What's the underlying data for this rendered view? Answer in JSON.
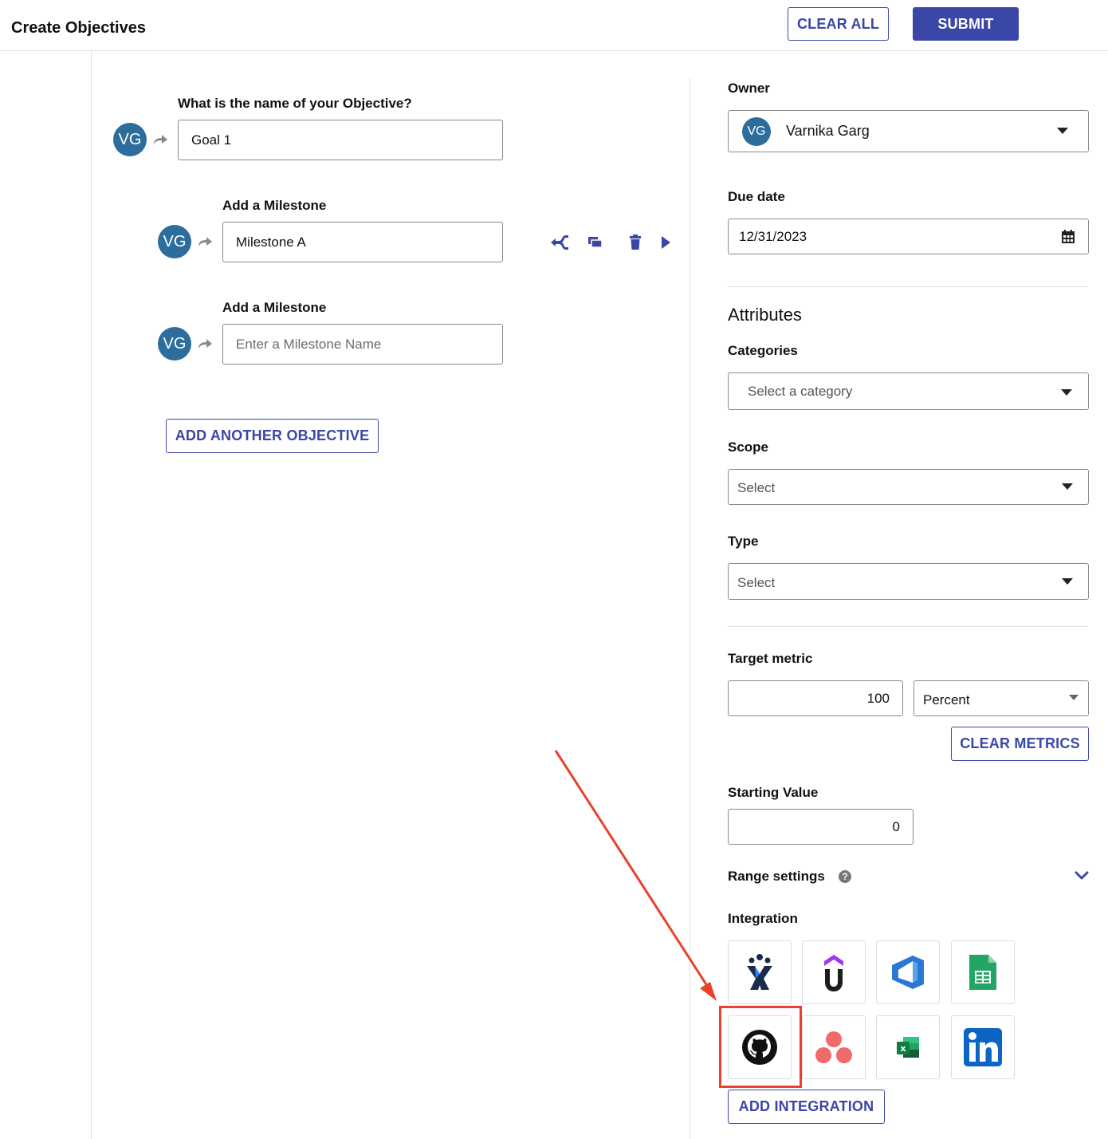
{
  "header": {
    "title": "Create Objectives",
    "clear_all_label": "CLEAR ALL",
    "submit_label": "SUBMIT"
  },
  "objective": {
    "question": "What is the name of your Objective?",
    "avatar_initials": "VG",
    "name_value": "Goal 1"
  },
  "milestones": [
    {
      "label": "Add a Milestone",
      "avatar_initials": "VG",
      "value": "Milestone A",
      "placeholder": ""
    },
    {
      "label": "Add a Milestone",
      "avatar_initials": "VG",
      "value": "",
      "placeholder": "Enter a Milestone Name"
    }
  ],
  "milestone_actions": [
    "branch-icon",
    "copy-icon",
    "trash-icon",
    "play-icon"
  ],
  "add_objective_label": "ADD ANOTHER OBJECTIVE",
  "owner": {
    "label": "Owner",
    "avatar_initials": "VG",
    "name": "Varnika Garg"
  },
  "due_date": {
    "label": "Due date",
    "value": "12/31/2023"
  },
  "attributes": {
    "heading": "Attributes",
    "categories_label": "Categories",
    "categories_placeholder": "Select a category",
    "scope_label": "Scope",
    "scope_placeholder": "Select",
    "type_label": "Type",
    "type_placeholder": "Select"
  },
  "target_metric": {
    "label": "Target metric",
    "value": "100",
    "unit": "Percent",
    "clear_metrics_label": "CLEAR METRICS"
  },
  "starting_value": {
    "label": "Starting Value",
    "value": "0"
  },
  "range_settings": {
    "label": "Range settings"
  },
  "integration": {
    "label": "Integration",
    "tiles": [
      "jira-icon",
      "udemy-icon",
      "azure-devops-icon",
      "google-sheets-icon",
      "github-icon",
      "asana-icon",
      "excel-icon",
      "linkedin-icon"
    ],
    "selected": "github-icon",
    "add_label": "ADD INTEGRATION"
  },
  "colors": {
    "accent": "#3b47a6",
    "avatar": "#2c6d9c",
    "annotation": "#e8432a"
  }
}
